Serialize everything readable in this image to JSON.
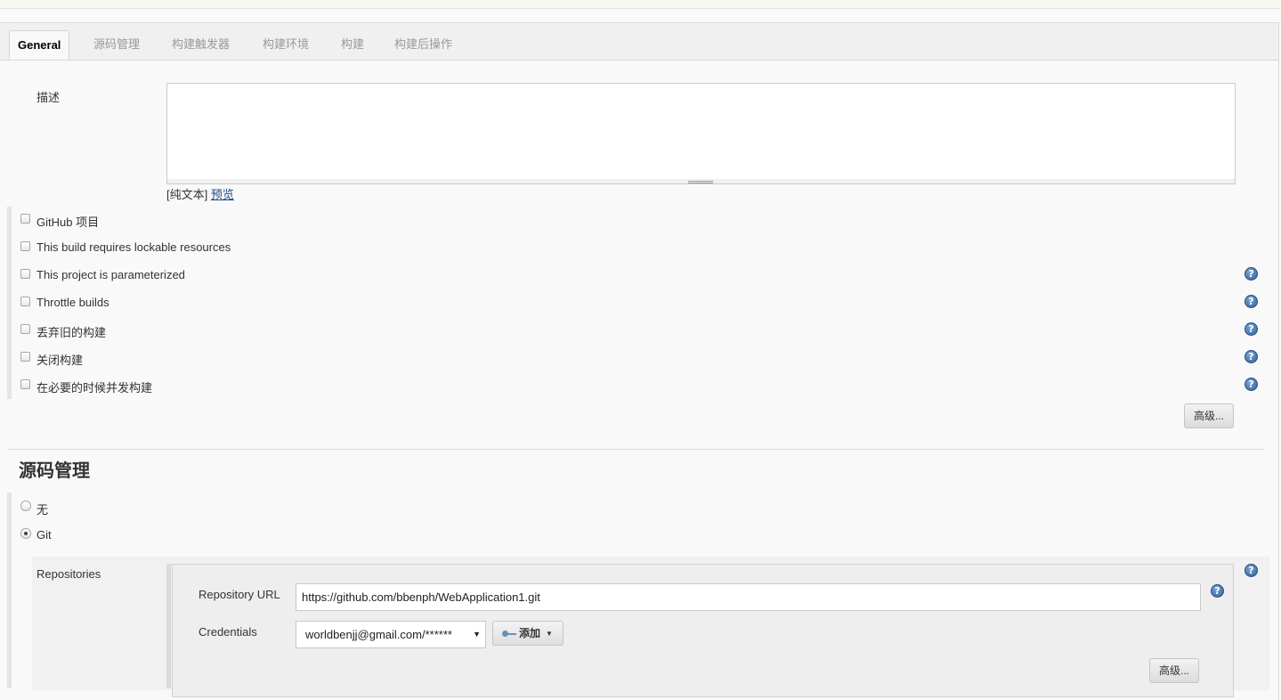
{
  "tabs": [
    {
      "label": "General",
      "active": true
    },
    {
      "label": "源码管理"
    },
    {
      "label": "构建触发器"
    },
    {
      "label": "构建环境"
    },
    {
      "label": "构建"
    },
    {
      "label": "构建后操作"
    }
  ],
  "general": {
    "description_label": "描述",
    "description_value": "",
    "markup_prefix": "[纯文本]",
    "preview_link": "预览",
    "options": [
      {
        "label": "GitHub 项目",
        "checked": false,
        "help": false
      },
      {
        "label": "This build requires lockable resources",
        "checked": false,
        "help": false
      },
      {
        "label": "This project is parameterized",
        "checked": false,
        "help": true
      },
      {
        "label": "Throttle builds",
        "checked": false,
        "help": true
      },
      {
        "label": "丢弃旧的构建",
        "checked": false,
        "help": true
      },
      {
        "label": "关闭构建",
        "checked": false,
        "help": true
      },
      {
        "label": "在必要的时候并发构建",
        "checked": false,
        "help": true
      }
    ],
    "advanced_button": "高级..."
  },
  "scm": {
    "title": "源码管理",
    "options": [
      {
        "label": "无",
        "selected": false
      },
      {
        "label": "Git",
        "selected": true
      }
    ],
    "repositories_label": "Repositories",
    "repository_url_label": "Repository URL",
    "repository_url_value": "https://github.com/bbenph/WebApplication1.git",
    "credentials_label": "Credentials",
    "credentials_selected": "worldbenjj@gmail.com/******",
    "add_button": "添加",
    "advanced_button": "高级..."
  },
  "icons": {
    "help": "help-icon",
    "key": "key-icon",
    "dropdown": "chevron-down-icon"
  }
}
